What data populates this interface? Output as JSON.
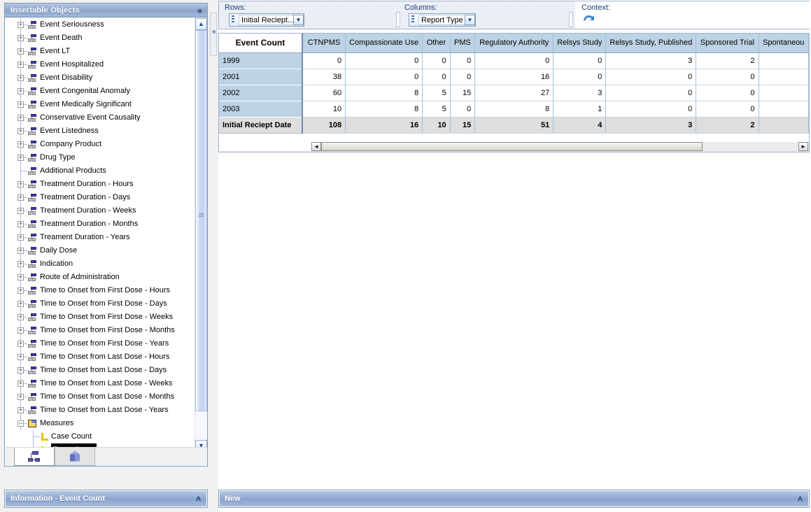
{
  "sidebar": {
    "title": "Insertable Objects",
    "collapse_glyph": "«",
    "tree": [
      {
        "label": "Event Seriousness",
        "icon": "dimension-icon",
        "expander": "+",
        "level": 0
      },
      {
        "label": "Event Death",
        "icon": "dimension-icon",
        "expander": "+",
        "level": 0
      },
      {
        "label": "Event LT",
        "icon": "dimension-icon",
        "expander": "+",
        "level": 0
      },
      {
        "label": "Event Hospitalized",
        "icon": "dimension-icon",
        "expander": "+",
        "level": 0
      },
      {
        "label": "Event Disability",
        "icon": "dimension-icon",
        "expander": "+",
        "level": 0
      },
      {
        "label": "Event Congenital Anomaly",
        "icon": "dimension-icon",
        "expander": "+",
        "level": 0
      },
      {
        "label": "Event Medically Significant",
        "icon": "dimension-icon",
        "expander": "+",
        "level": 0
      },
      {
        "label": "Conservative Event Causality",
        "icon": "dimension-icon",
        "expander": "+",
        "level": 0
      },
      {
        "label": "Event Listedness",
        "icon": "dimension-icon",
        "expander": "+",
        "level": 0
      },
      {
        "label": "Company Product",
        "icon": "dimension-icon",
        "expander": "+",
        "level": 0
      },
      {
        "label": "Drug Type",
        "icon": "dimension-icon",
        "expander": "+",
        "level": 0
      },
      {
        "label": "Additional Products",
        "icon": "dimension-icon",
        "expander": "",
        "level": 0
      },
      {
        "label": "Treatment Duration - Hours",
        "icon": "dimension-icon",
        "expander": "+",
        "level": 0
      },
      {
        "label": "Treatment Duration - Days",
        "icon": "dimension-icon",
        "expander": "+",
        "level": 0
      },
      {
        "label": "Treatment Duration - Weeks",
        "icon": "dimension-icon",
        "expander": "+",
        "level": 0
      },
      {
        "label": "Treatment Duration - Months",
        "icon": "dimension-icon",
        "expander": "+",
        "level": 0
      },
      {
        "label": "Treament Duration - Years",
        "icon": "dimension-icon",
        "expander": "+",
        "level": 0
      },
      {
        "label": "Daily Dose",
        "icon": "dimension-icon",
        "expander": "+",
        "level": 0
      },
      {
        "label": "Indication",
        "icon": "dimension-icon",
        "expander": "+",
        "level": 0
      },
      {
        "label": "Route of Administration",
        "icon": "dimension-icon",
        "expander": "+",
        "level": 0
      },
      {
        "label": "Time to Onset from First Dose - Hours",
        "icon": "dimension-icon",
        "expander": "+",
        "level": 0
      },
      {
        "label": "Time to Onset from First Dose - Days",
        "icon": "dimension-icon",
        "expander": "+",
        "level": 0
      },
      {
        "label": "Time to Onset from First Dose - Weeks",
        "icon": "dimension-icon",
        "expander": "+",
        "level": 0
      },
      {
        "label": "Time to Onset from First Dose - Months",
        "icon": "dimension-icon",
        "expander": "+",
        "level": 0
      },
      {
        "label": "Time to Onset from First Dose - Years",
        "icon": "dimension-icon",
        "expander": "+",
        "level": 0
      },
      {
        "label": "Time to Onset from Last Dose - Hours",
        "icon": "dimension-icon",
        "expander": "+",
        "level": 0
      },
      {
        "label": "Time to Onset from Last Dose - Days",
        "icon": "dimension-icon",
        "expander": "+",
        "level": 0
      },
      {
        "label": "Time to Onset from Last Dose - Weeks",
        "icon": "dimension-icon",
        "expander": "+",
        "level": 0
      },
      {
        "label": "Time to Onset from Last Dose - Months",
        "icon": "dimension-icon",
        "expander": "+",
        "level": 0
      },
      {
        "label": "Time to Onset from Last Dose - Years",
        "icon": "dimension-icon",
        "expander": "+",
        "level": 0
      },
      {
        "label": "Measures",
        "icon": "measures-icon",
        "expander": "−",
        "level": 0
      },
      {
        "label": "Case Count",
        "icon": "measure-leaf-icon",
        "expander": "",
        "level": 1
      },
      {
        "label": "Event Count",
        "icon": "measure-leaf-icon",
        "expander": "",
        "level": 1,
        "selected": true
      }
    ],
    "tabs": [
      {
        "name": "metadata-tab",
        "icon": "hierarchy-icon",
        "active": true
      },
      {
        "name": "cube-tab",
        "icon": "cube-icon",
        "active": false
      }
    ],
    "scrollbar": {
      "up_glyph": "▲",
      "down_glyph": "▼"
    }
  },
  "info_panel": {
    "title": "Information - Event Count",
    "collapse_glyph": "˄"
  },
  "toolbar": {
    "rows_label": "Rows:",
    "rows_value": "Initial Reciept...",
    "columns_label": "Columns:",
    "columns_value": "Report Type",
    "context_label": "Context:",
    "context_icon": "refresh-arrow-icon",
    "dropdown_glyph": "▼"
  },
  "grid": {
    "corner_label": "Event Count",
    "columns": [
      "CTNPMS",
      "Compassionate Use",
      "Other",
      "PMS",
      "Regulatory Authority",
      "Relsys Study",
      "Relsys Study, Published",
      "Sponsored Trial",
      "Spontaneou"
    ],
    "rows": [
      {
        "label": "1999",
        "values": [
          "0",
          "0",
          "0",
          "0",
          "0",
          "0",
          "3",
          "2",
          ""
        ]
      },
      {
        "label": "2001",
        "values": [
          "38",
          "0",
          "0",
          "0",
          "16",
          "0",
          "0",
          "0",
          ""
        ]
      },
      {
        "label": "2002",
        "values": [
          "60",
          "8",
          "5",
          "15",
          "27",
          "3",
          "0",
          "0",
          ""
        ]
      },
      {
        "label": "2003",
        "values": [
          "10",
          "8",
          "5",
          "0",
          "8",
          "1",
          "0",
          "0",
          ""
        ]
      }
    ],
    "total_row": {
      "label": "Initial Reciept Date",
      "values": [
        "108",
        "16",
        "10",
        "15",
        "51",
        "4",
        "3",
        "2",
        ""
      ]
    },
    "hscroll": {
      "left_glyph": "◄",
      "right_glyph": "►"
    }
  },
  "new_panel": {
    "title": "New",
    "collapse_glyph": "˄"
  }
}
